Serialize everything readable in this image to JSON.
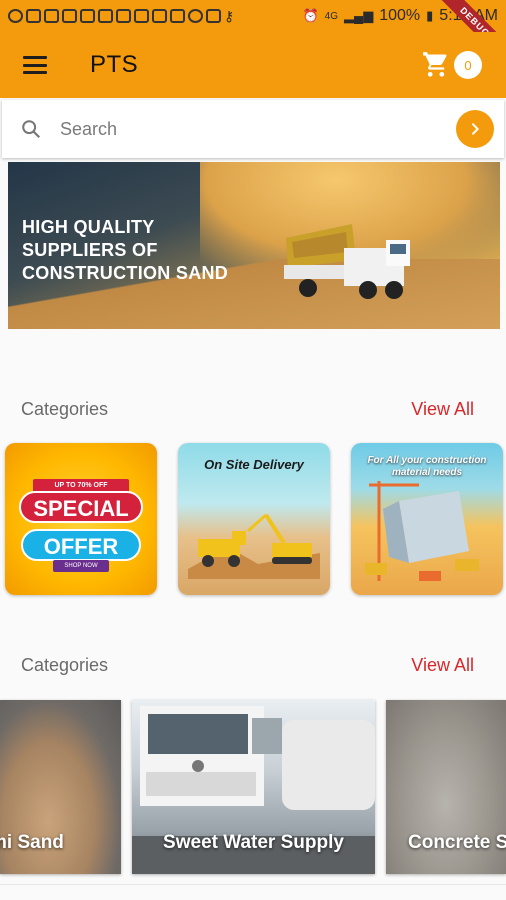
{
  "status_bar": {
    "battery": "100%",
    "time": "5:16 AM",
    "network": "4G"
  },
  "debug_banner": "DEBUG",
  "app_bar": {
    "title": "PTS",
    "cart_count": "0"
  },
  "search": {
    "placeholder": "Search"
  },
  "banner": {
    "headline_line1": "HIGH QUALITY",
    "headline_line2": "SUPPLIERS OF",
    "headline_line3": "CONSTRUCTION SAND"
  },
  "categories_section": {
    "label": "Categories",
    "view_all": "View All",
    "items": [
      {
        "tag": "UP TO 70% OFF",
        "line1": "SPECIAL",
        "line2": "OFFER",
        "shop": "SHOP NOW"
      },
      {
        "caption": "On Site Delivery"
      },
      {
        "caption": "For All your construction material needs"
      }
    ]
  },
  "products_section": {
    "label": "Categories",
    "view_all": "View All",
    "items": [
      {
        "name": "mi Sand"
      },
      {
        "name": "Sweet Water Supply"
      },
      {
        "name": "Concrete S"
      }
    ]
  },
  "colors": {
    "accent": "#f49b0d",
    "link": "#d8282a",
    "badge_text": "#f49b0d"
  }
}
